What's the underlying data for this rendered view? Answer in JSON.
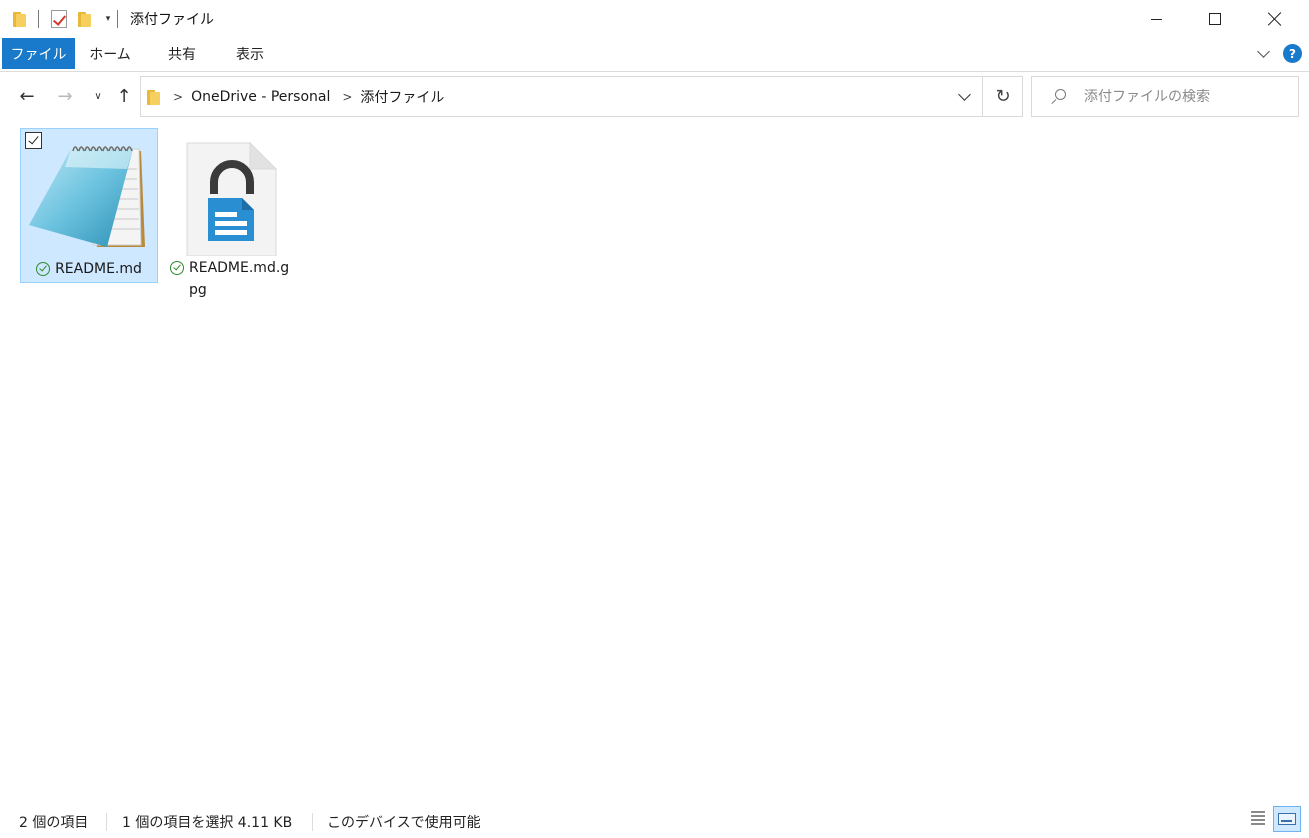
{
  "window": {
    "title": "添付ファイル",
    "qat_dropdown_glyph": "▾"
  },
  "ribbon": {
    "tabs": [
      {
        "label": "ファイル",
        "active": true
      },
      {
        "label": "ホーム"
      },
      {
        "label": "共有"
      },
      {
        "label": "表示"
      }
    ],
    "help_glyph": "?",
    "accent_color": "#1979ca"
  },
  "nav": {
    "back_glyph": "←",
    "forward_glyph": "→",
    "recent_glyph": "∨",
    "up_glyph": "↑",
    "breadcrumb": [
      "OneDrive - Personal",
      "添付ファイル"
    ],
    "crumb_separator": ">",
    "refresh_glyph": "↻",
    "search_placeholder": "添付ファイルの検索"
  },
  "files": [
    {
      "name": "README.md",
      "icon": "notepad-icon",
      "selected": true,
      "sync_status": "available-on-device"
    },
    {
      "name": "README.md.gpg",
      "icon": "locked-document-icon",
      "selected": false,
      "sync_status": "available-on-device"
    }
  ],
  "status": {
    "item_count": "2 個の項目",
    "selection": "1 個の項目を選択  4.11 KB",
    "availability": "このデバイスで使用可能"
  }
}
